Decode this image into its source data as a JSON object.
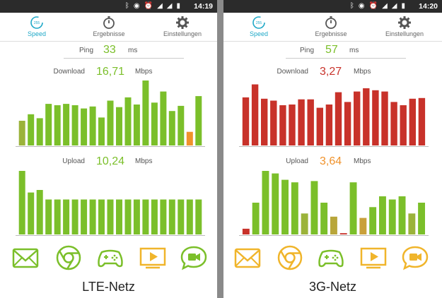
{
  "panels": [
    {
      "status": {
        "time": "14:19",
        "icons": [
          "bluetooth-icon",
          "cast-icon",
          "alarm-icon",
          "signal-icon",
          "lte-icon",
          "signal-icon",
          "battery-icon"
        ]
      },
      "tabs": [
        {
          "label": "Speed",
          "active": true,
          "gauge": "255"
        },
        {
          "label": "Ergebnisse",
          "active": false
        },
        {
          "label": "Einstellungen",
          "active": false
        }
      ],
      "ping": {
        "label": "Ping",
        "value": "33",
        "unit": "ms"
      },
      "download": {
        "label": "Download",
        "value": "16,71",
        "unit": "Mbps",
        "color": "#7bbf2a"
      },
      "upload": {
        "label": "Upload",
        "value": "10,24",
        "unit": "Mbps",
        "color": "#7bbf2a"
      },
      "network_label": "LTE-Netz",
      "app_color": "#7bbf2a",
      "download_bars": [
        {
          "v": 0.38,
          "c": "#9bb33a"
        },
        {
          "v": 0.48,
          "c": "#7bbf2a"
        },
        {
          "v": 0.42,
          "c": "#7bbf2a"
        },
        {
          "v": 0.64,
          "c": "#7bbf2a"
        },
        {
          "v": 0.62,
          "c": "#7bbf2a"
        },
        {
          "v": 0.64,
          "c": "#7bbf2a"
        },
        {
          "v": 0.62,
          "c": "#7bbf2a"
        },
        {
          "v": 0.57,
          "c": "#7bbf2a"
        },
        {
          "v": 0.6,
          "c": "#7bbf2a"
        },
        {
          "v": 0.43,
          "c": "#7bbf2a"
        },
        {
          "v": 0.69,
          "c": "#7bbf2a"
        },
        {
          "v": 0.59,
          "c": "#7bbf2a"
        },
        {
          "v": 0.74,
          "c": "#7bbf2a"
        },
        {
          "v": 0.63,
          "c": "#7bbf2a"
        },
        {
          "v": 1.0,
          "c": "#7bbf2a"
        },
        {
          "v": 0.66,
          "c": "#7bbf2a"
        },
        {
          "v": 0.83,
          "c": "#7bbf2a"
        },
        {
          "v": 0.53,
          "c": "#7bbf2a"
        },
        {
          "v": 0.61,
          "c": "#7bbf2a"
        },
        {
          "v": 0.21,
          "c": "#f0922b"
        },
        {
          "v": 0.76,
          "c": "#7bbf2a"
        }
      ],
      "upload_bars": [
        {
          "v": 1.0,
          "c": "#7bbf2a"
        },
        {
          "v": 0.66,
          "c": "#7bbf2a"
        },
        {
          "v": 0.7,
          "c": "#7bbf2a"
        },
        {
          "v": 0.55,
          "c": "#7bbf2a"
        },
        {
          "v": 0.55,
          "c": "#7bbf2a"
        },
        {
          "v": 0.55,
          "c": "#7bbf2a"
        },
        {
          "v": 0.55,
          "c": "#7bbf2a"
        },
        {
          "v": 0.55,
          "c": "#7bbf2a"
        },
        {
          "v": 0.55,
          "c": "#7bbf2a"
        },
        {
          "v": 0.55,
          "c": "#7bbf2a"
        },
        {
          "v": 0.55,
          "c": "#7bbf2a"
        },
        {
          "v": 0.55,
          "c": "#7bbf2a"
        },
        {
          "v": 0.55,
          "c": "#7bbf2a"
        },
        {
          "v": 0.55,
          "c": "#7bbf2a"
        },
        {
          "v": 0.55,
          "c": "#7bbf2a"
        },
        {
          "v": 0.55,
          "c": "#7bbf2a"
        },
        {
          "v": 0.55,
          "c": "#7bbf2a"
        },
        {
          "v": 0.55,
          "c": "#7bbf2a"
        },
        {
          "v": 0.55,
          "c": "#7bbf2a"
        },
        {
          "v": 0.55,
          "c": "#7bbf2a"
        },
        {
          "v": 0.55,
          "c": "#7bbf2a"
        }
      ]
    },
    {
      "status": {
        "time": "14:20",
        "icons": [
          "bluetooth-icon",
          "cast-icon",
          "alarm-icon",
          "signal-icon",
          "h-plus-icon",
          "signal-icon",
          "battery-icon"
        ]
      },
      "tabs": [
        {
          "label": "Speed",
          "active": true,
          "gauge": "255"
        },
        {
          "label": "Ergebnisse",
          "active": false
        },
        {
          "label": "Einstellungen",
          "active": false
        }
      ],
      "ping": {
        "label": "Ping",
        "value": "57",
        "unit": "ms"
      },
      "download": {
        "label": "Download",
        "value": "3,27",
        "unit": "Mbps",
        "color": "#c8322a"
      },
      "upload": {
        "label": "Upload",
        "value": "3,64",
        "unit": "Mbps",
        "color": "#f0922b"
      },
      "network_label": "3G-Netz",
      "app_color": "#f0b52b",
      "download_bars": [
        {
          "v": 0.74,
          "c": "#c8322a"
        },
        {
          "v": 0.94,
          "c": "#c8322a"
        },
        {
          "v": 0.72,
          "c": "#c8322a"
        },
        {
          "v": 0.69,
          "c": "#c8322a"
        },
        {
          "v": 0.62,
          "c": "#c8322a"
        },
        {
          "v": 0.63,
          "c": "#c8322a"
        },
        {
          "v": 0.71,
          "c": "#c8322a"
        },
        {
          "v": 0.71,
          "c": "#c8322a"
        },
        {
          "v": 0.58,
          "c": "#c8322a"
        },
        {
          "v": 0.63,
          "c": "#c8322a"
        },
        {
          "v": 0.82,
          "c": "#c8322a"
        },
        {
          "v": 0.67,
          "c": "#c8322a"
        },
        {
          "v": 0.83,
          "c": "#c8322a"
        },
        {
          "v": 0.88,
          "c": "#c8322a"
        },
        {
          "v": 0.85,
          "c": "#c8322a"
        },
        {
          "v": 0.83,
          "c": "#c8322a"
        },
        {
          "v": 0.67,
          "c": "#c8322a"
        },
        {
          "v": 0.62,
          "c": "#c8322a"
        },
        {
          "v": 0.72,
          "c": "#c8322a"
        },
        {
          "v": 0.73,
          "c": "#c8322a"
        }
      ],
      "upload_bars": [
        {
          "v": 0.09,
          "c": "#c8322a"
        },
        {
          "v": 0.5,
          "c": "#7bbf2a"
        },
        {
          "v": 1.0,
          "c": "#7bbf2a"
        },
        {
          "v": 0.96,
          "c": "#7bbf2a"
        },
        {
          "v": 0.86,
          "c": "#7bbf2a"
        },
        {
          "v": 0.82,
          "c": "#7bbf2a"
        },
        {
          "v": 0.33,
          "c": "#9bb33a"
        },
        {
          "v": 0.84,
          "c": "#7bbf2a"
        },
        {
          "v": 0.5,
          "c": "#7bbf2a"
        },
        {
          "v": 0.28,
          "c": "#b8a63a"
        },
        {
          "v": 0.02,
          "c": "#c8322a"
        },
        {
          "v": 0.82,
          "c": "#7bbf2a"
        },
        {
          "v": 0.26,
          "c": "#c9a03a"
        },
        {
          "v": 0.43,
          "c": "#7bbf2a"
        },
        {
          "v": 0.6,
          "c": "#7bbf2a"
        },
        {
          "v": 0.55,
          "c": "#7bbf2a"
        },
        {
          "v": 0.6,
          "c": "#7bbf2a"
        },
        {
          "v": 0.33,
          "c": "#9bb33a"
        },
        {
          "v": 0.5,
          "c": "#7bbf2a"
        }
      ]
    }
  ]
}
